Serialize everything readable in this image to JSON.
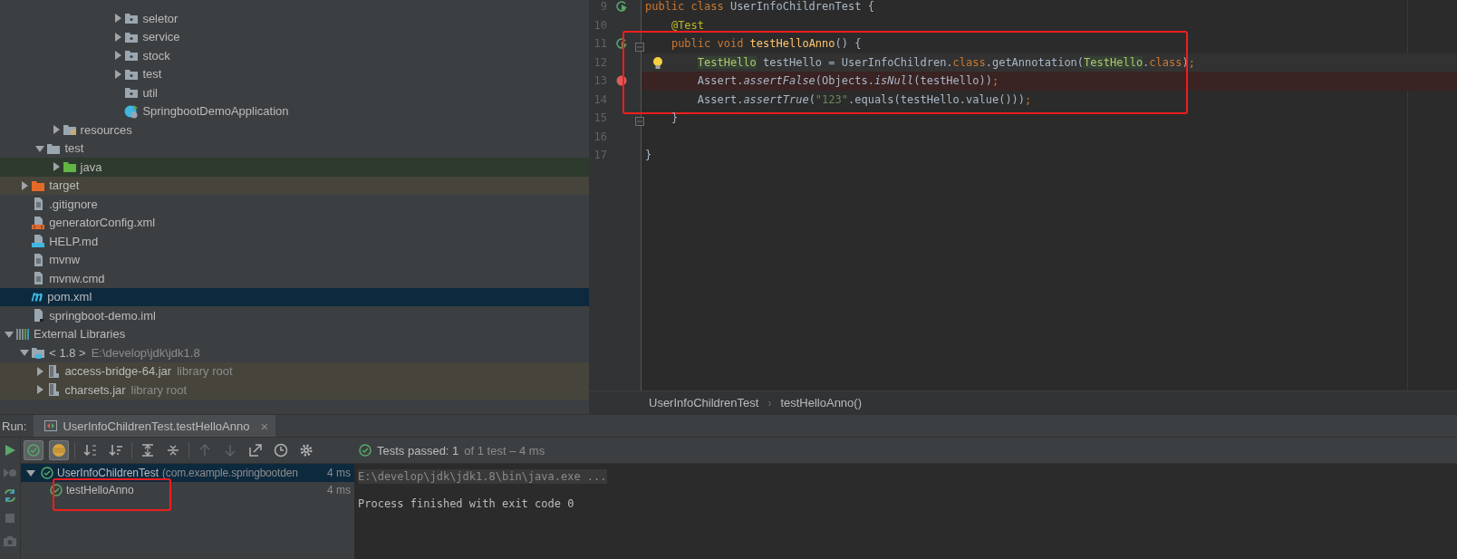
{
  "project_tree": [
    {
      "children": [
        {
          "children": [
            {
              "children": [
                {
                  "children": [
                    {
                      "children": [
                        {
                          "children": [
                            {
                              "children": [
                                {
                                  "name": "seletor",
                                  "kind": "package",
                                  "expanded": false,
                                  "selected": false
                                },
                                {
                                  "name": "service",
                                  "kind": "package",
                                  "expanded": false,
                                  "selected": false
                                },
                                {
                                  "name": "stock",
                                  "kind": "package",
                                  "expanded": false,
                                  "selected": false
                                },
                                {
                                  "name": "test",
                                  "kind": "package",
                                  "expanded": false,
                                  "selected": false
                                },
                                {
                                  "name": "util",
                                  "kind": "package",
                                  "selected": false
                                },
                                {
                                  "name": "SpringbootDemoApplication",
                                  "kind": "spring-class",
                                  "selected": false
                                }
                              ]
                            }
                          ]
                        }
                      ]
                    }
                  ]
                },
                {
                  "name": "resources",
                  "kind": "resources-folder",
                  "expanded": false,
                  "selected": false
                }
              ]
            },
            {
              "name": "test",
              "kind": "folder",
              "expanded": true,
              "selected": false,
              "children": [
                {
                  "name": "java",
                  "kind": "test-folder",
                  "expanded": false,
                  "selected": false
                }
              ]
            }
          ]
        },
        {
          "name": "target",
          "kind": "excluded-folder",
          "expanded": false,
          "selected": false
        },
        {
          "name": ".gitignore",
          "kind": "file",
          "selected": false
        },
        {
          "name": "generatorConfig.xml",
          "kind": "xml",
          "selected": false
        },
        {
          "name": "HELP.md",
          "kind": "markdown",
          "selected": false
        },
        {
          "name": "mvnw",
          "kind": "file",
          "selected": false
        },
        {
          "name": "mvnw.cmd",
          "kind": "file",
          "selected": false
        },
        {
          "name": "pom.xml",
          "kind": "maven",
          "selected": true
        },
        {
          "name": "springboot-demo.iml",
          "kind": "iml",
          "selected": false
        }
      ]
    },
    {
      "name": "External Libraries",
      "kind": "libraries",
      "expanded": true,
      "selected": false,
      "children": [
        {
          "name": "< 1.8 >",
          "note": "E:\\develop\\jdk\\jdk1.8",
          "kind": "jdk",
          "expanded": true,
          "selected": false,
          "children": [
            {
              "name": "access-bridge-64.jar",
              "note": "library root",
              "kind": "jar",
              "expanded": false,
              "selected": false
            },
            {
              "name": "charsets.jar",
              "note": "library root",
              "kind": "jar",
              "expanded": false,
              "selected": false
            }
          ]
        }
      ]
    }
  ],
  "editor": {
    "lines": [
      {
        "number": "9",
        "run": true,
        "tokens": [
          {
            "kind": "kw",
            "t": "public class "
          },
          {
            "kind": "plain",
            "t": "UserInfoChildrenTest {"
          }
        ]
      },
      {
        "number": "10",
        "tokens": [
          {
            "kind": "ann",
            "t": "    @Test"
          }
        ]
      },
      {
        "number": "11",
        "run": true,
        "fold": true,
        "framed": true,
        "tokens": [
          {
            "kind": "kw",
            "t": "    public void "
          },
          {
            "kind": "decl",
            "t": "testHelloAnno"
          },
          {
            "kind": "plain",
            "t": "() {"
          }
        ]
      },
      {
        "number": "12",
        "current": true,
        "bulb": true,
        "framed": true,
        "tokens": [
          {
            "kind": "type",
            "t": "        TestHello"
          },
          {
            "kind": "plain",
            "t": " testHello = UserInfoChildren."
          },
          {
            "kind": "kw",
            "t": "class"
          },
          {
            "kind": "plain",
            "t": ".getAnnotation("
          },
          {
            "kind": "type",
            "t": "TestHello"
          },
          {
            "kind": "plain",
            "t": "."
          },
          {
            "kind": "kw",
            "t": "class"
          },
          {
            "kind": "plain",
            "t": ")"
          },
          {
            "kind": "kw",
            "t": ";"
          }
        ]
      },
      {
        "number": "13",
        "breakpoint": true,
        "framed": true,
        "tokens": [
          {
            "kind": "plain",
            "t": "        Assert."
          },
          {
            "kind": "italic",
            "t": "assertFalse"
          },
          {
            "kind": "plain",
            "t": "(Objects."
          },
          {
            "kind": "italic",
            "t": "isNull"
          },
          {
            "kind": "plain",
            "t": "(testHello))"
          },
          {
            "kind": "kw",
            "t": ";"
          }
        ]
      },
      {
        "number": "14",
        "framed": true,
        "tokens": [
          {
            "kind": "plain",
            "t": "        Assert."
          },
          {
            "kind": "italic",
            "t": "assertTrue"
          },
          {
            "kind": "plain",
            "t": "("
          },
          {
            "kind": "str",
            "t": "\"123\""
          },
          {
            "kind": "plain",
            "t": ".equals(testHello.value()))"
          },
          {
            "kind": "kw",
            "t": ";"
          }
        ]
      },
      {
        "number": "15",
        "fold": true,
        "tokens": [
          {
            "kind": "plain",
            "t": "    }"
          }
        ]
      },
      {
        "number": "16"
      },
      {
        "number": "17",
        "tokens": [
          {
            "kind": "plain",
            "t": "}"
          }
        ]
      }
    ],
    "breadcrumbs": {
      "separator": "›",
      "items": [
        "UserInfoChildrenTest",
        "testHelloAnno()"
      ]
    }
  },
  "run_panel": {
    "label": "Run:",
    "tab": {
      "title": "UserInfoChildrenTest.testHelloAnno",
      "close": "×",
      "selected": true
    },
    "side_tools": [
      {
        "kind": "run",
        "disabled": false
      },
      {
        "kind": "rerun-failed",
        "disabled": true
      },
      {
        "kind": "auto-test",
        "disabled": false
      },
      {
        "kind": "stop",
        "disabled": true
      },
      {
        "kind": "camera",
        "disabled": true
      }
    ],
    "tools": [
      {
        "kind": "passed",
        "on": true
      },
      {
        "kind": "ignored",
        "on": true
      },
      {
        "kind": "sep"
      },
      {
        "kind": "sort-alpha"
      },
      {
        "kind": "sort-duration"
      },
      {
        "kind": "sep"
      },
      {
        "kind": "expand"
      },
      {
        "kind": "collapse"
      },
      {
        "kind": "sep"
      },
      {
        "kind": "up",
        "disabled": true
      },
      {
        "kind": "down",
        "disabled": true
      },
      {
        "kind": "export"
      },
      {
        "kind": "history"
      },
      {
        "kind": "settings"
      }
    ],
    "status": {
      "label": "Tests passed: 1",
      "detail": "of 1 test – 4 ms"
    },
    "tests": [
      {
        "name": "UserInfoChildrenTest",
        "package": "(com.example.springbootden",
        "time": "4 ms",
        "expanded": true,
        "selected": true,
        "children": [
          {
            "name": "testHelloAnno",
            "time": "4 ms",
            "selected": false,
            "framed": true
          }
        ]
      }
    ],
    "console": [
      {
        "text": "E:\\develop\\jdk\\jdk1.8\\bin\\java.exe ...",
        "kind": "folded"
      },
      {
        "text": "Process finished with exit code 0",
        "kind": "normal"
      }
    ]
  }
}
